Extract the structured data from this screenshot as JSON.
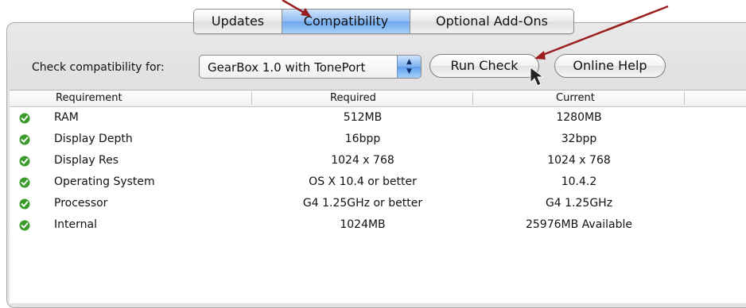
{
  "tabs": [
    {
      "label": "Updates",
      "active": false
    },
    {
      "label": "Compatibility",
      "active": true
    },
    {
      "label": "Optional Add-Ons",
      "active": false
    }
  ],
  "check": {
    "label": "Check compatibility for:",
    "selected_device": "GearBox 1.0 with TonePort",
    "stepper_glyph": "▲▼",
    "run_check_label": "Run Check",
    "online_help_label": "Online Help"
  },
  "table": {
    "columns": [
      "Requirement",
      "Required",
      "Current"
    ],
    "rows": [
      {
        "requirement": "RAM",
        "required": "512MB",
        "current": "1280MB"
      },
      {
        "requirement": "Display Depth",
        "required": "16bpp",
        "current": "32bpp"
      },
      {
        "requirement": "Display Res",
        "required": "1024 x 768",
        "current": "1024 x 768"
      },
      {
        "requirement": "Operating System",
        "required": "OS X 10.4 or better",
        "current": "10.4.2"
      },
      {
        "requirement": "Processor",
        "required": "G4 1.25GHz or better",
        "current": "G4 1.25GHz"
      },
      {
        "requirement": "Internal",
        "required": "1024MB",
        "current": "25976MB Available"
      }
    ]
  },
  "colors": {
    "accent_blue": "#8fbcf2",
    "check_green": "#3a9a2a",
    "arrow_red": "#9b1c1c"
  }
}
